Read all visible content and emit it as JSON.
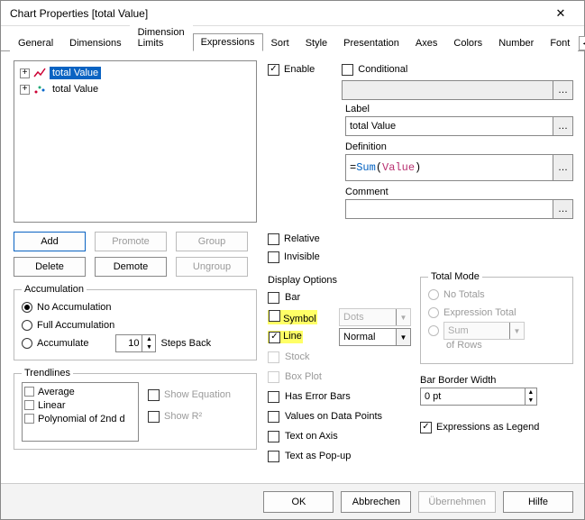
{
  "window": {
    "title": "Chart Properties [total Value]"
  },
  "tabs": {
    "items": [
      "General",
      "Dimensions",
      "Dimension Limits",
      "Expressions",
      "Sort",
      "Style",
      "Presentation",
      "Axes",
      "Colors",
      "Number",
      "Font"
    ],
    "active_index": 3
  },
  "tree": {
    "items": [
      {
        "label": "total Value",
        "selected": true
      },
      {
        "label": "total Value",
        "selected": false
      }
    ]
  },
  "buttons": {
    "add": "Add",
    "promote": "Promote",
    "group": "Group",
    "delete": "Delete",
    "demote": "Demote",
    "ungroup": "Ungroup"
  },
  "accumulation": {
    "legend": "Accumulation",
    "no_acc": "No Accumulation",
    "full_acc": "Full Accumulation",
    "accumulate": "Accumulate",
    "steps_value": "10",
    "steps_back": "Steps Back",
    "selected": "no_acc"
  },
  "trendlines": {
    "legend": "Trendlines",
    "items": [
      "Average",
      "Linear",
      "Polynomial of 2nd d"
    ],
    "show_equation": "Show Equation",
    "show_r2": "Show R²"
  },
  "right": {
    "enable": "Enable",
    "conditional": "Conditional",
    "label_label": "Label",
    "label_value": "total Value",
    "definition_label": "Definition",
    "definition_prefix": "=",
    "definition_func": "Sum",
    "definition_open": "(",
    "definition_arg": "Value",
    "definition_close": ")",
    "comment_label": "Comment",
    "comment_value": "",
    "relative": "Relative",
    "invisible": "Invisible",
    "display_options": "Display Options",
    "bar": "Bar",
    "symbol": "Symbol",
    "symbol_combo": "Dots",
    "line": "Line",
    "line_combo": "Normal",
    "stock": "Stock",
    "box_plot": "Box Plot",
    "has_error_bars": "Has Error Bars",
    "values_on_dp": "Values on Data Points",
    "text_on_axis": "Text on Axis",
    "text_as_popup": "Text as Pop-up"
  },
  "total_mode": {
    "legend": "Total Mode",
    "no_totals": "No Totals",
    "expr_total": "Expression Total",
    "sum": "Sum",
    "of_rows": "of Rows"
  },
  "bar_border": {
    "label": "Bar Border Width",
    "value": "0 pt"
  },
  "expr_as_legend": "Expressions as Legend",
  "footer": {
    "ok": "OK",
    "cancel": "Abbrechen",
    "apply": "Übernehmen",
    "help": "Hilfe"
  }
}
